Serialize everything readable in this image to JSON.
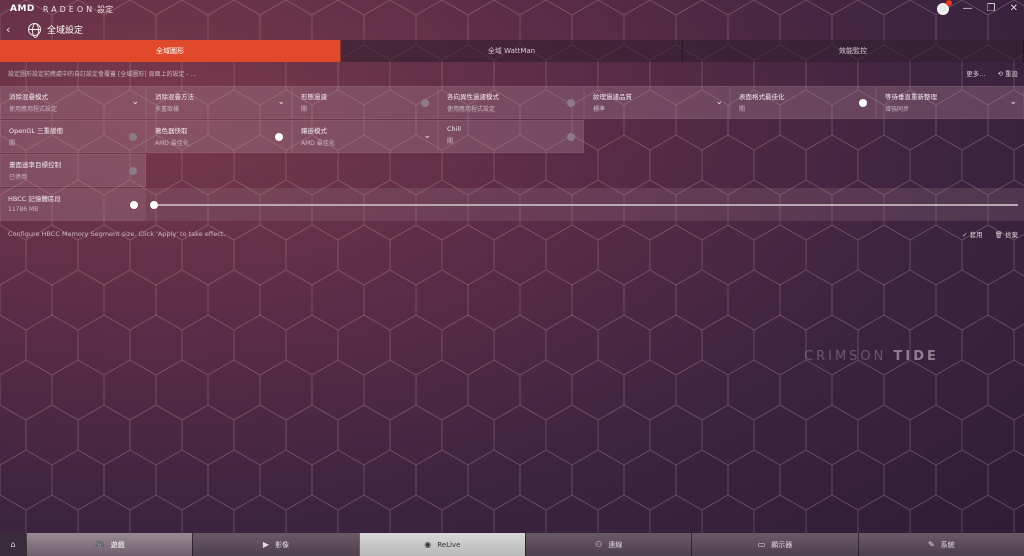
{
  "app": {
    "brand": "AMD",
    "product": "RADEON",
    "product_suffix": "設定"
  },
  "header": {
    "title": "全域設定"
  },
  "tabs": [
    {
      "label": "全域圖形",
      "active": true
    },
    {
      "label": "全域 WattMan",
      "active": false
    },
    {
      "label": "效能監控",
      "active": false
    }
  ],
  "info_text": "設定圖形設定前應處中的自訂設定會覆蓋 [全域圖形] 頁面上的設定 - ...",
  "top_actions": {
    "more": "更多...",
    "reset": "重設"
  },
  "settings_row1": [
    {
      "name": "消除混疊模式",
      "value": "使用應用程式設定",
      "control": "dropdown"
    },
    {
      "name": "消除混疊方法",
      "value": "多重取樣",
      "control": "dropdown"
    },
    {
      "name": "形態過濾",
      "value": "關",
      "control": "toggle-off"
    },
    {
      "name": "各向異性過濾模式",
      "value": "使用應用程式設定",
      "control": "toggle-off"
    },
    {
      "name": "紋理過濾品質",
      "value": "標準",
      "control": "dropdown"
    },
    {
      "name": "表面格式最佳化",
      "value": "開",
      "control": "toggle-on"
    },
    {
      "name": "等待垂直重新整理",
      "value": "增強同步",
      "control": "dropdown"
    }
  ],
  "settings_row2": [
    {
      "name": "OpenGL 三重緩衝",
      "value": "關",
      "control": "toggle-off"
    },
    {
      "name": "著色器快取",
      "value": "AMD 最佳化",
      "control": "toggle-on"
    },
    {
      "name": "鑲嵌模式",
      "value": "AMD 最佳化",
      "control": "dropdown"
    },
    {
      "name": "Chill",
      "value": "關",
      "control": "toggle-off"
    }
  ],
  "settings_row3": [
    {
      "name": "畫面速率目標控制",
      "value": "已停用",
      "control": "toggle-off"
    }
  ],
  "hbcc": {
    "name": "HBCC 記憶體區段",
    "value": "11786 MB",
    "enabled": true,
    "slider_fraction": 0.0
  },
  "hbcc_description": "Configure HBCC Memory Segment size. Click 'Apply' to take effect.",
  "bottom_actions": {
    "apply": "套用",
    "discard": "捨棄"
  },
  "watermark": {
    "left": "CRIMSON",
    "right": "TIDE"
  },
  "nav": [
    {
      "label": "遊戲",
      "icon": "gamepad-icon",
      "active": true
    },
    {
      "label": "影像",
      "icon": "play-icon",
      "active": false
    },
    {
      "label": "ReLive",
      "icon": "relive-icon",
      "active": false
    },
    {
      "label": "連線",
      "icon": "connect-icon",
      "active": false
    },
    {
      "label": "顯示器",
      "icon": "monitor-icon",
      "active": false
    },
    {
      "label": "系統",
      "icon": "wrench-icon",
      "active": false
    }
  ]
}
